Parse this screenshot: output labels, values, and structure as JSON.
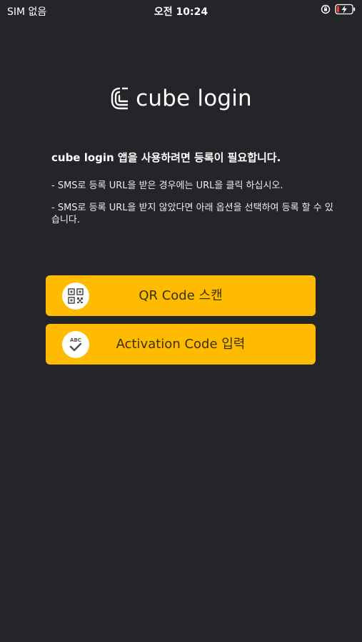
{
  "status_bar": {
    "carrier": "SIM 없음",
    "time": "오전 10:24"
  },
  "logo": {
    "text": "cube login",
    "mark_icon": "cube-login-logo-icon"
  },
  "intro": {
    "headline": "cube login 앱을 사용하려면 등록이 필요합니다.",
    "line1": " - SMS로 등록 URL을 받은 경우에는 URL을 클릭 하십시오.",
    "line2": " - SMS로 등록 URL을 받지 않았다면 아래 옵션을 선택하여 등록 할 수 있습니다."
  },
  "buttons": {
    "qr_scan": {
      "label": "QR Code 스캔",
      "icon": "qr-code-icon"
    },
    "activation_code": {
      "label": "Activation Code 입력",
      "icon": "abc-check-icon",
      "icon_text": "ABC"
    }
  },
  "colors": {
    "background": "#242528",
    "button": "#ffbb00",
    "button_text": "#3a3000",
    "battery_bolt": "#ff3b30"
  }
}
